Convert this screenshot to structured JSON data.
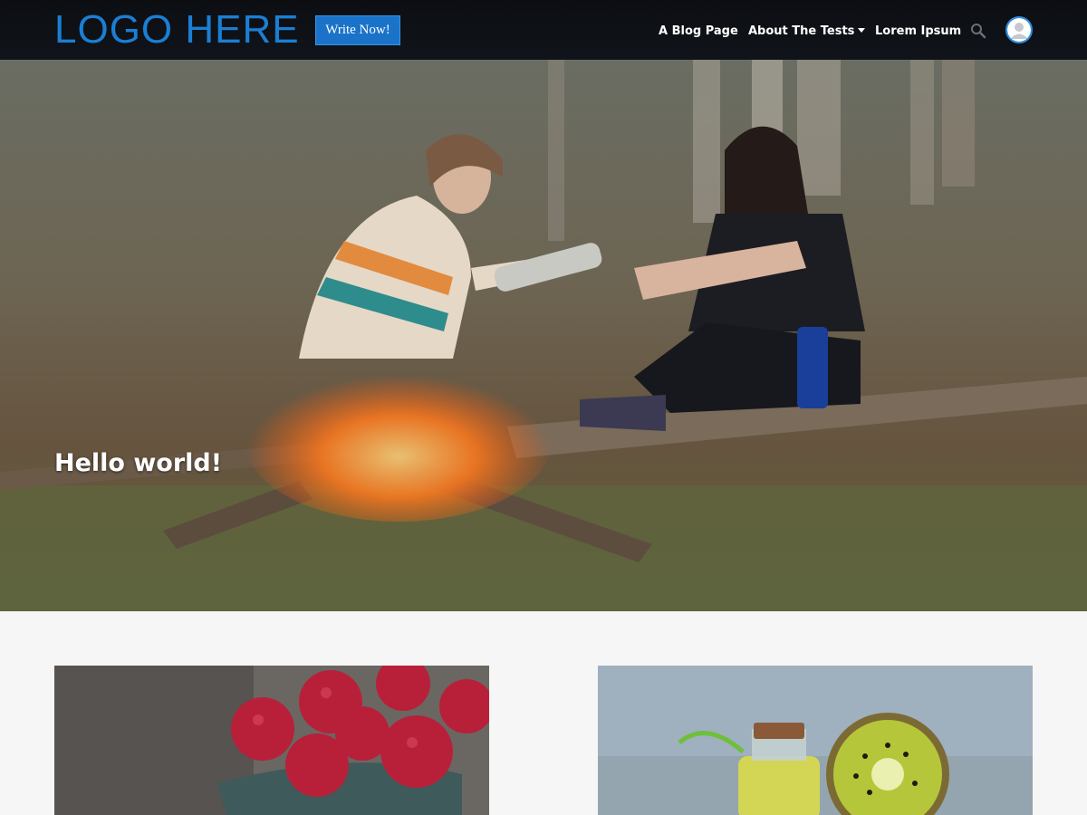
{
  "header": {
    "logo_text": "LOGO HERE",
    "write_button_label": "Write Now!",
    "nav": [
      {
        "label": "A Blog Page",
        "has_dropdown": false
      },
      {
        "label": "About The Tests",
        "has_dropdown": true
      },
      {
        "label": "Lorem Ipsum",
        "has_dropdown": false
      }
    ],
    "search_icon": "search-icon",
    "avatar_icon": "user-avatar-icon"
  },
  "hero": {
    "title": "Hello world!"
  },
  "colors": {
    "accent": "#1a73c9",
    "logo": "#1a7fd4",
    "header_bg": "#0c0e12",
    "page_bg": "#f6f6f6"
  }
}
